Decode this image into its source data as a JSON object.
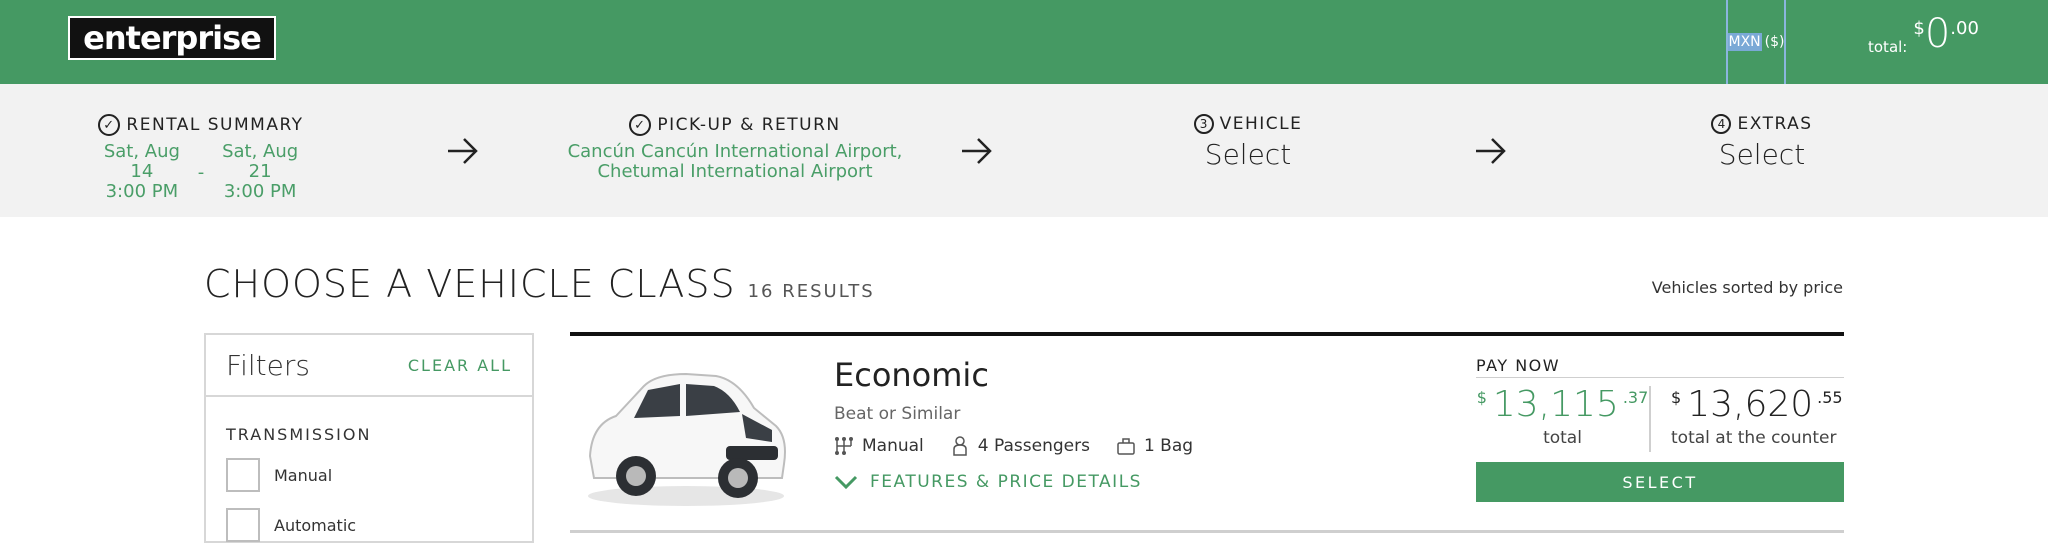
{
  "header": {
    "logo_text": "enterprise",
    "currency_code": "MXN",
    "currency_symbol": "($)",
    "total_label": "total:",
    "total_dollar": "$",
    "total_amount": "0",
    "total_cents": ".00",
    "bg_color": "#459963"
  },
  "steps": {
    "rental_summary": {
      "title": "RENTAL SUMMARY",
      "pickup_date": "Sat, Aug 14",
      "pickup_time": "3:00 PM",
      "separator": "-",
      "return_date": "Sat, Aug 21",
      "return_time": "3:00 PM"
    },
    "pickup_return": {
      "title": "PICK-UP & RETURN",
      "line1": "Cancún Cancún International Airport,",
      "line2": "Chetumal International Airport"
    },
    "vehicle": {
      "number": "3",
      "title": "VEHICLE",
      "value": "Select"
    },
    "extras": {
      "number": "4",
      "title": "EXTRAS",
      "value": "Select"
    }
  },
  "main": {
    "title": "CHOOSE A VEHICLE CLASS",
    "results_count": "16 RESULTS",
    "sort_text": "Vehicles sorted by price"
  },
  "filters": {
    "title": "Filters",
    "clear_all": "CLEAR ALL",
    "transmission": {
      "title": "TRANSMISSION",
      "options": [
        "Manual",
        "Automatic"
      ]
    }
  },
  "vehicle_card": {
    "name": "Economic",
    "similar": "Beat or Similar",
    "transmission": "Manual",
    "passengers": "4 Passengers",
    "bags": "1 Bag",
    "details_link": "FEATURES & PRICE DETAILS",
    "pay_now": "PAY NOW",
    "price_pay_now": {
      "symbol": "$",
      "amount": "13,115",
      "cents": ".37",
      "label": "total"
    },
    "price_counter": {
      "symbol": "$",
      "amount": "13,620",
      "cents": ".55",
      "label": "total at the counter"
    },
    "select_label": "SELECT"
  }
}
